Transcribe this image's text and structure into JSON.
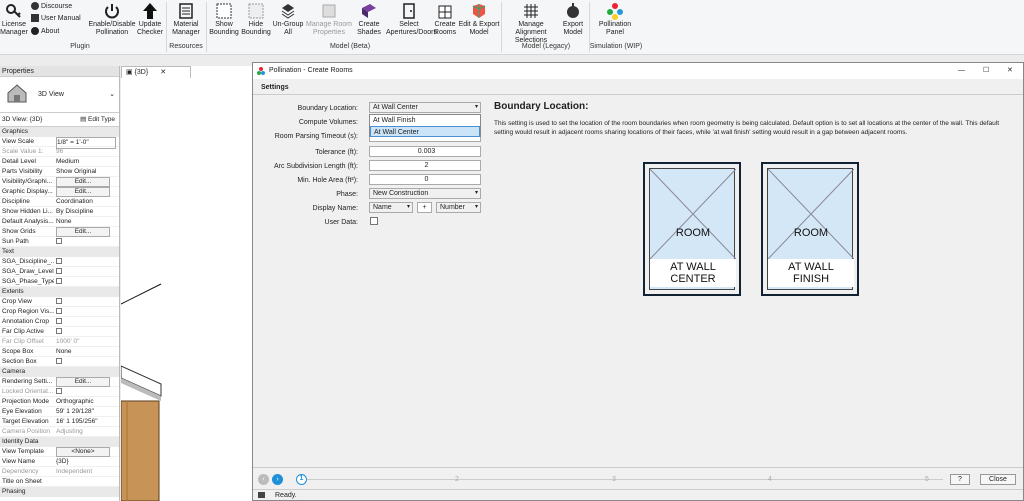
{
  "ribbon": {
    "license_manager": "License\nManager",
    "discourse": "Discourse",
    "user_manual": "User Manual",
    "about": "About",
    "enable_disable": "Enable/Disable\nPollination",
    "update_checker": "Update\nChecker",
    "plugin_group": "Plugin",
    "material_manager": "Material\nManager",
    "resources_group": "Resources",
    "show_bounding": "Show\nBounding",
    "hide_bounding": "Hide\nBounding",
    "ungroup_all": "Un-Group\nAll",
    "manage_room_properties": "Manage Room\nProperties",
    "create_shades": "Create\nShades",
    "select_apertures": "Select\nApertures/Doors",
    "create_rooms": "Create\nRooms",
    "edit_export": "Edit & Export\nModel",
    "model_beta_group": "Model (Beta)",
    "manage_alignment": "Manage Alignment\nSelections",
    "export_model": "Export\nModel",
    "model_legacy_group": "Model (Legacy)",
    "pollination_panel": "Pollination\nPanel",
    "simulation_group": "Simulation (WIP)"
  },
  "properties": {
    "title": "Properties",
    "type_name": "3D View",
    "view_selector": "3D View: {3D}",
    "edit_type": "Edit Type",
    "sections": {
      "graphics": "Graphics",
      "text": "Text",
      "extents": "Extents",
      "camera": "Camera",
      "identity": "Identity Data",
      "phasing": "Phasing"
    },
    "rows_graphics": [
      {
        "k": "View Scale",
        "v": "1/8\" = 1'-0\""
      },
      {
        "k": "Scale Value 1:",
        "v": "96"
      },
      {
        "k": "Detail Level",
        "v": "Medium"
      },
      {
        "k": "Parts Visibility",
        "v": "Show Original"
      },
      {
        "k": "Visibility/Graphi...",
        "v": "Edit..."
      },
      {
        "k": "Graphic Display...",
        "v": "Edit..."
      },
      {
        "k": "Discipline",
        "v": "Coordination"
      },
      {
        "k": "Show Hidden Li...",
        "v": "By Discipline"
      },
      {
        "k": "Default Analysis...",
        "v": "None"
      },
      {
        "k": "Show Grids",
        "v": "Edit..."
      },
      {
        "k": "Sun Path",
        "v": ""
      }
    ],
    "rows_text": [
      {
        "k": "SGA_Discipline_..."
      },
      {
        "k": "SGA_Draw_Level"
      },
      {
        "k": "SGA_Phase_Type"
      }
    ],
    "rows_extents": [
      {
        "k": "Crop View",
        "v": ""
      },
      {
        "k": "Crop Region Vis...",
        "v": ""
      },
      {
        "k": "Annotation Crop",
        "v": ""
      },
      {
        "k": "Far Clip Active",
        "v": ""
      },
      {
        "k": "Far Clip Offset",
        "v": "1000' 0\""
      },
      {
        "k": "Scope Box",
        "v": "None"
      },
      {
        "k": "Section Box",
        "v": ""
      }
    ],
    "rows_camera": [
      {
        "k": "Rendering Setti...",
        "v": "Edit..."
      },
      {
        "k": "Locked Orientat...",
        "v": ""
      },
      {
        "k": "Projection Mode",
        "v": "Orthographic"
      },
      {
        "k": "Eye Elevation",
        "v": "59'  1 29/128\""
      },
      {
        "k": "Target Elevation",
        "v": "16'  1 195/256\""
      },
      {
        "k": "Camera Position",
        "v": "Adjusting"
      }
    ],
    "rows_identity": [
      {
        "k": "View Template",
        "v": "<None>"
      },
      {
        "k": "View Name",
        "v": "{3D}"
      },
      {
        "k": "Dependency",
        "v": "Independent"
      },
      {
        "k": "Title on Sheet",
        "v": ""
      }
    ]
  },
  "view": {
    "tab_label": "{3D}"
  },
  "dialog": {
    "title": "Pollination - Create Rooms",
    "section": "Settings",
    "labels": {
      "boundary": "Boundary Location:",
      "compute": "Compute Volumes:",
      "parsing": "Room Parsing Timeout (s):",
      "tolerance": "Tolerance (ft):",
      "arc": "Arc Subdivision Length (ft):",
      "hole": "Min. Hole Area (ft²):",
      "phase": "Phase:",
      "display": "Display Name:",
      "userdata": "User Data:"
    },
    "values": {
      "boundary": "At Wall Center",
      "tolerance": "0.003",
      "arc": "2",
      "hole": "0",
      "phase": "New Construction",
      "display_a": "Name",
      "display_plus": "+",
      "display_b": "Number"
    },
    "dropdown_options": [
      "At Wall Finish",
      "At Wall Center"
    ],
    "help_title": "Boundary Location:",
    "help_text": "This setting is used to set the location of the room boundaries when room geometry is being calculated. Default option is to set all locations at the center of the wall. This default setting would result in adjacent rooms sharing locations of their faces, while 'at wall finish' setting would result in a gap between adjacent rooms.",
    "card1": {
      "room": "ROOM",
      "line1": "AT WALL",
      "line2": "CENTER"
    },
    "card2": {
      "room": "ROOM",
      "line1": "AT WALL",
      "line2": "FINISH"
    },
    "steps": [
      "1",
      "2",
      "3",
      "4",
      "5"
    ],
    "help_button": "?",
    "close_button": "Close",
    "status": "Ready."
  }
}
